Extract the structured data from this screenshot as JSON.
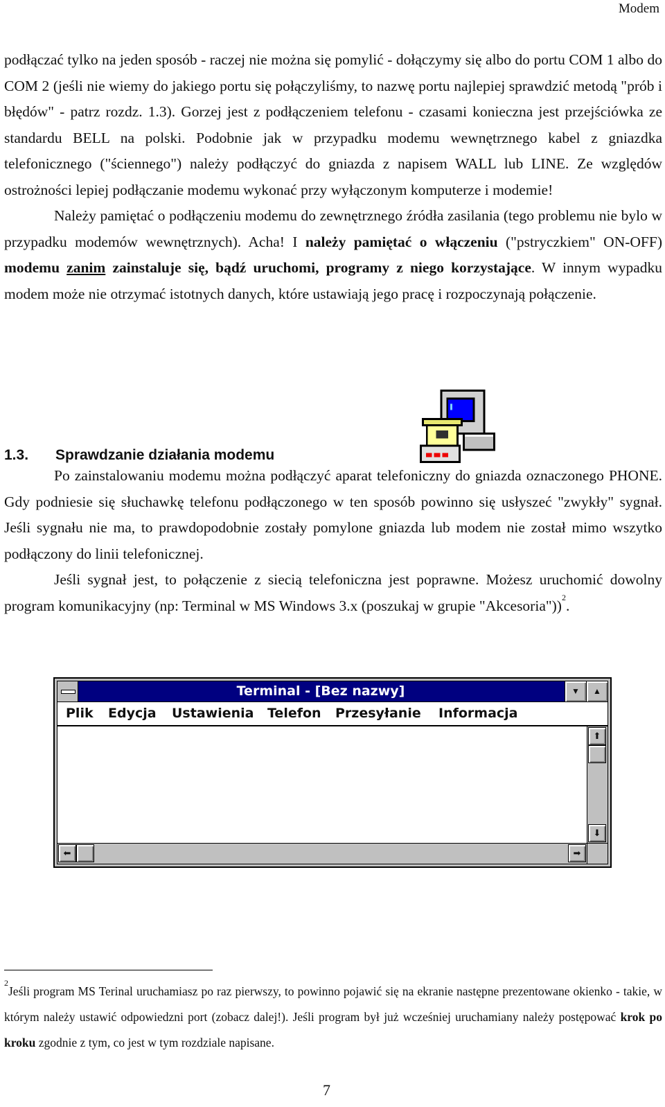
{
  "header": {
    "running_title": "Modem"
  },
  "body": {
    "p1": "podłączać tylko na jeden sposób - raczej nie można się pomylić - dołączymy się albo do portu COM 1 albo do COM 2 (jeśli nie wiemy do jakiego portu się połączyliśmy, to nazwę portu najlepiej sprawdzić metodą \"prób i błędów\" - patrz rozdz. 1.3). Gorzej jest z podłączeniem telefonu - czasami konieczna jest przejściówka ze standardu BELL na polski. Podobnie jak w przypadku modemu wewnętrznego kabel z gniazdka telefonicznego (\"ściennego\") należy podłączyć do gniazda z napisem WALL lub LINE. Ze względów ostrożności lepiej podłączanie modemu wykonać przy wyłączonym komputerze i modemie!",
    "p2_a": "Należy pamiętać o podłączeniu modemu do zewnętrznego źródła zasilania (tego problemu nie bylo w przypadku modemów wewnętrznych). Acha! I ",
    "p2_b1": "należy pamiętać o włączeniu",
    "p2_c": " (\"pstryczkiem\" ON-OFF) ",
    "p2_b2": "modemu ",
    "p2_u": "zanim",
    "p2_b3": " zainstaluje się, bądź uruchomi, programy z niego korzystające",
    "p2_d": ". W innym wypadku modem może nie otrzymać istotnych danych, które ustawiają jego pracę i rozpoczynają połączenie."
  },
  "section": {
    "number": "1.3.",
    "title": "Sprawdzanie działania modemu",
    "icon": "modem-telephone-computer-icon",
    "p1": "Po zainstalowaniu modemu można podłączyć aparat telefoniczny do gniazda oznaczonego PHONE. Gdy podniesie się słuchawkę telefonu podłączonego w ten sposób powinno się usłyszeć \"zwykły\" sygnał. Jeśli sygnału nie ma, to prawdopodobnie zostały pomylone gniazda lub modem nie został mimo wszytko podłączony do linii telefonicznej.",
    "p2": "Jeśli sygnał jest, to połączenie z siecią telefoniczna jest poprawne. Możesz uruchomić dowolny program komunikacyjny (np: Terminal w MS Windows 3.x (poszukaj w grupie \"Akcesoria\"))",
    "p2_footref": "2",
    "p2_end": "."
  },
  "terminal": {
    "title": "Terminal - [Bez nazwy]",
    "menu": [
      "Plik",
      "Edycja",
      "Ustawienia",
      "Telefon",
      "Przesyłanie",
      "Informacja"
    ],
    "colors": {
      "titlebar": "#000080",
      "chrome": "#c0c0c0"
    }
  },
  "footnote": {
    "mark": "2",
    "text_a": "Jeśli program MS Terinal uruchamiasz po raz pierwszy, to powinno pojawić się na ekranie następne prezentowane okienko - takie, w którym należy ustawić odpowiedzni port (zobacz dalej!). Jeśli program był już wcześniej uruchamiany należy postępować ",
    "text_bold": "krok po kroku",
    "text_b": " zgodnie z tym, co jest w tym rozdziale napisane."
  },
  "page_number": "7"
}
